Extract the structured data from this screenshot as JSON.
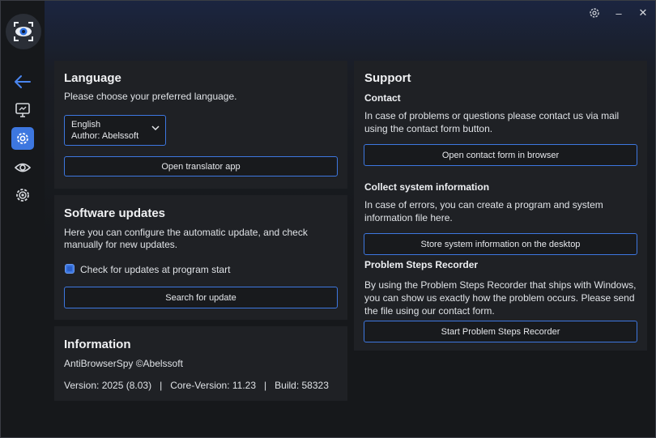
{
  "sidebar": {
    "items": [
      {
        "name": "back",
        "icon": "arrow-left-icon"
      },
      {
        "name": "monitor",
        "icon": "monitor-icon"
      },
      {
        "name": "settings",
        "icon": "gear-icon",
        "active": true
      },
      {
        "name": "eye",
        "icon": "eye-icon"
      },
      {
        "name": "advanced-settings",
        "icon": "gear-alt-icon"
      }
    ]
  },
  "titlebar": {
    "minimize": "–",
    "close": "✕"
  },
  "language": {
    "title": "Language",
    "description": "Please choose your preferred language.",
    "selected_language": "English",
    "selected_author": "Author: Abelssoft",
    "translator_button": "Open translator app"
  },
  "updates": {
    "title": "Software updates",
    "description_line1": "Here you can configure the automatic update, and check",
    "description_line2": "manually for new updates.",
    "checkbox_label": "Check for updates at program start",
    "checkbox_checked": true,
    "search_button": "Search for update"
  },
  "information": {
    "title": "Information",
    "product": "AntiBrowserSpy ©Abelssoft",
    "version_line": "Version: 2025 (8.03)   |   Core-Version: 11.23   |   Build: 58323"
  },
  "support": {
    "title": "Support",
    "contact_title": "Contact",
    "contact_line1": "In case of problems or questions please contact us via mail",
    "contact_line2": "using the contact form button.",
    "contact_button": "Open contact form in browser",
    "sysinfo_title": "Collect system information",
    "sysinfo_line1": "In case of errors, you can create a program and system",
    "sysinfo_line2": "information file here.",
    "sysinfo_button": "Store system information on the desktop",
    "psr_title": "Problem Steps Recorder",
    "psr_line1": "By using the Problem Steps Recorder that ships with Windows,",
    "psr_line2": "you can show us exactly how the problem occurs. Please send",
    "psr_line3": "the file using our contact form.",
    "psr_button": "Start Problem Steps Recorder"
  },
  "colors": {
    "accent": "#3d77e0",
    "card": "#1f2125",
    "sidebar": "#16181b"
  }
}
